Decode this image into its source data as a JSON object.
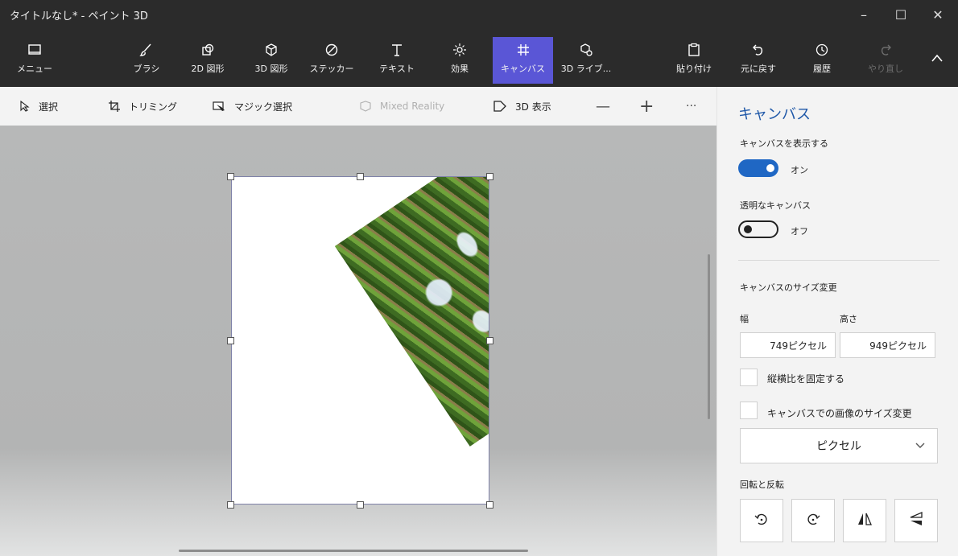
{
  "window": {
    "title": "タイトルなし* - ペイント 3D",
    "minimize": "–",
    "maximize": "☐",
    "close": "✕"
  },
  "ribbon": {
    "menu": "メニュー",
    "brush": "ブラシ",
    "shapes2d": "2D 図形",
    "shapes3d": "3D 図形",
    "stickers": "ステッカー",
    "text": "テキスト",
    "effects": "効果",
    "canvas": "キャンバス",
    "library3d": "3D ライブ...",
    "paste": "貼り付け",
    "undo": "元に戻す",
    "history": "履歴",
    "redo": "やり直し",
    "collapse": "^"
  },
  "toolbar": {
    "select": "選択",
    "crop": "トリミング",
    "magic_select": "マジック選択",
    "mixed_reality": "Mixed Reality",
    "view3d": "3D 表示",
    "zoom_out": "—",
    "zoom_in": "+",
    "more": "···"
  },
  "panel": {
    "title": "キャンバス",
    "show_canvas_label": "キャンバスを表示する",
    "show_canvas_state": "オン",
    "transparent_label": "透明なキャンバス",
    "transparent_state": "オフ",
    "resize_label": "キャンバスのサイズ変更",
    "width_label": "幅",
    "height_label": "高さ",
    "width_value": "749ピクセル",
    "height_value": "949ピクセル",
    "lock_aspect": "縦横比を固定する",
    "resize_image": "キャンバスでの画像のサイズ変更",
    "unit": "ピクセル",
    "rotate_label": "回転と反転"
  },
  "colors": {
    "accent": "#5a56d6",
    "toggle_on": "#1f67c4",
    "panel_title": "#1f58a8"
  }
}
